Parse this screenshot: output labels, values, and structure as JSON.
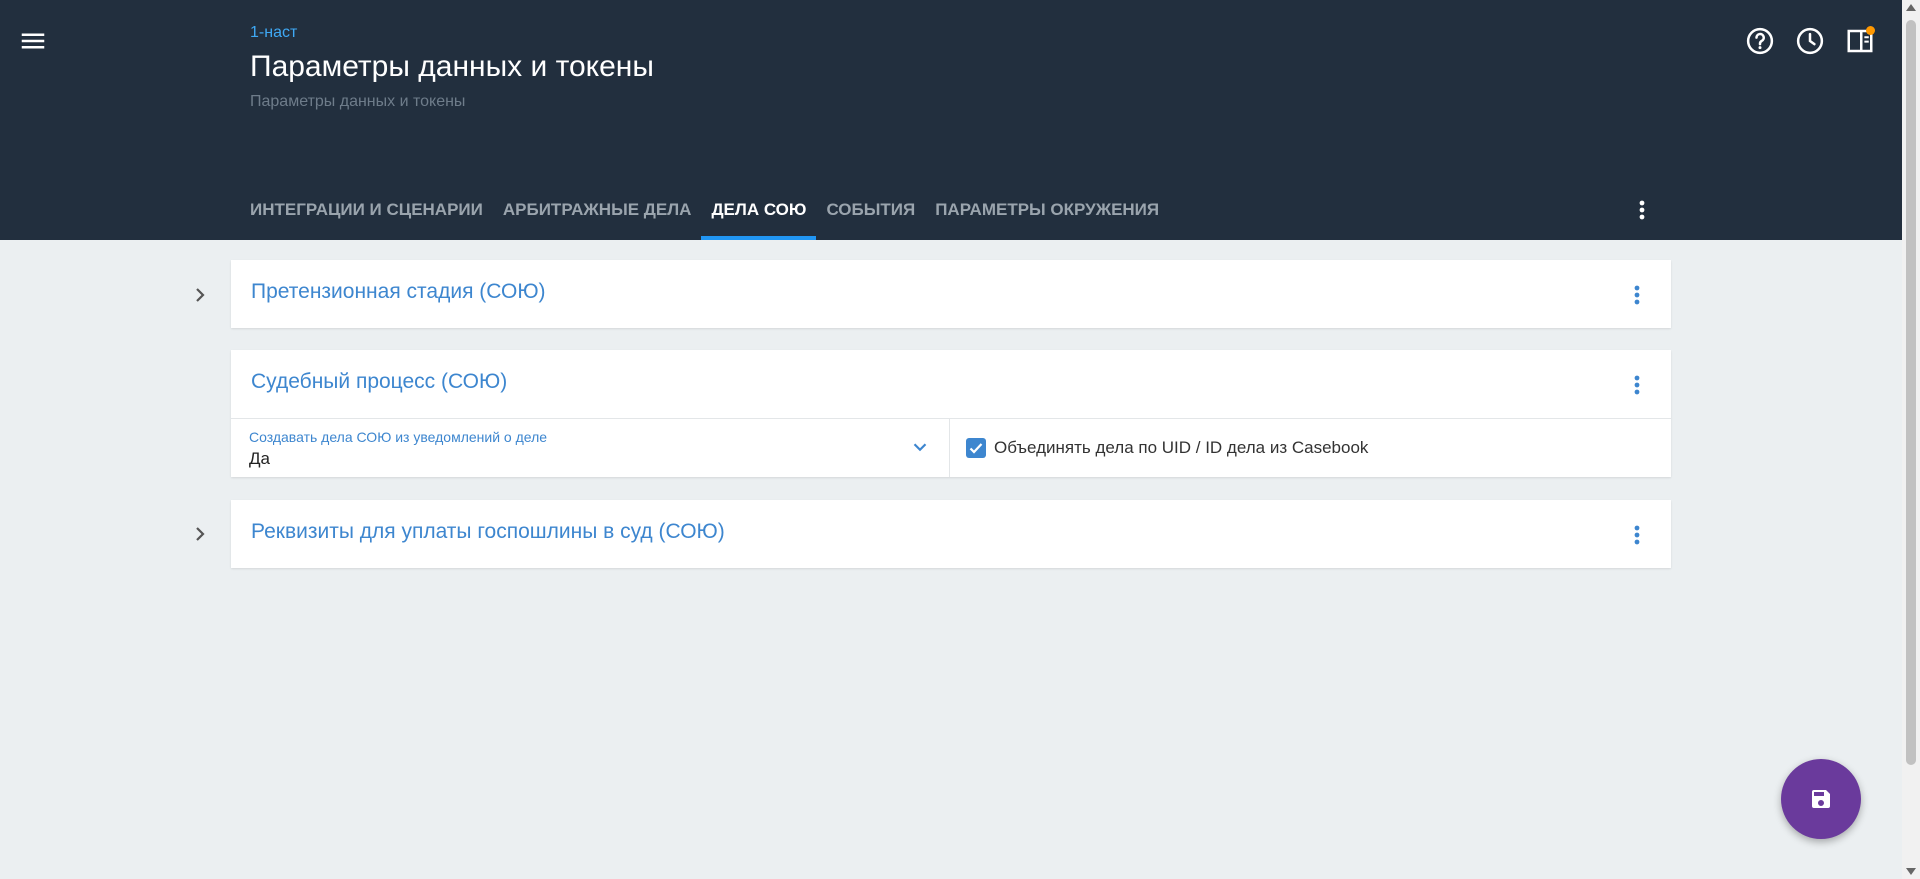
{
  "header": {
    "breadcrumb": "1-наст",
    "title": "Параметры данных и токены",
    "subtitle": "Параметры данных и токены",
    "icons": [
      "menu-icon",
      "help-icon",
      "history-icon",
      "panel-icon"
    ]
  },
  "tabs": [
    {
      "label": "ИНТЕГРАЦИИ И СЦЕНАРИИ",
      "active": false
    },
    {
      "label": "АРБИТРАЖНЫЕ ДЕЛА",
      "active": false
    },
    {
      "label": "ДЕЛА СОЮ",
      "active": true
    },
    {
      "label": "СОБЫТИЯ",
      "active": false
    },
    {
      "label": "ПАРАМЕТРЫ ОКРУЖЕНИЯ",
      "active": false
    }
  ],
  "sections": [
    {
      "title": "Претензионная стадия (СОЮ)",
      "expanded": false
    },
    {
      "title": "Судебный процесс (СОЮ)",
      "expanded": true,
      "select": {
        "label": "Создавать дела СОЮ из уведомлений о деле",
        "value": "Да"
      },
      "checkbox": {
        "label": "Объединять дела по UID / ID дела из Casebook",
        "checked": true
      }
    },
    {
      "title": "Реквизиты для уплаты госпошлины в суд (СОЮ)",
      "expanded": false
    }
  ],
  "colors": {
    "header_bg": "#222f3e",
    "accent": "#3d86cf",
    "tab_indicator": "#2196f3",
    "fab": "#6a3a9c",
    "badge": "#ff9800",
    "page_bg": "#ebeff1"
  },
  "fab": {
    "icon": "save-icon"
  }
}
